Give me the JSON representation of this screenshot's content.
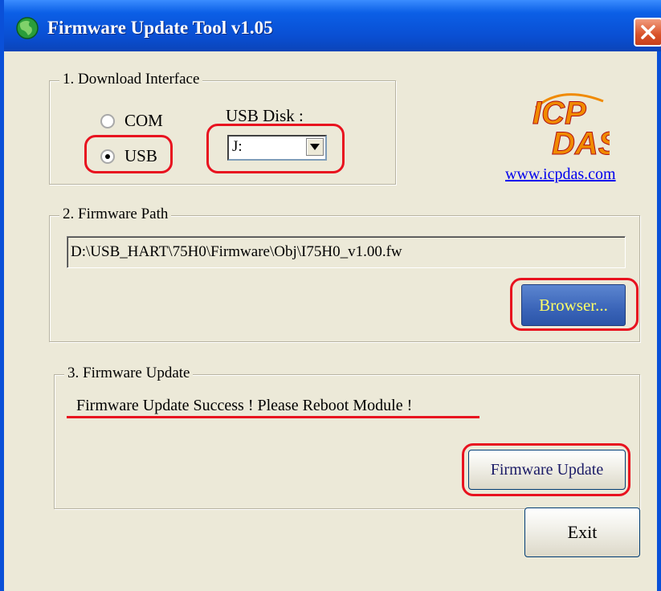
{
  "window": {
    "title": "Firmware Update Tool v1.05"
  },
  "interface_group": {
    "legend": "1. Download Interface",
    "radio_com": "COM",
    "radio_usb": "USB",
    "selected": "USB",
    "usb_disk_label": "USB Disk :",
    "usb_disk_value": "J:"
  },
  "brand": {
    "logo_top": "ICP",
    "logo_bottom": "DAS",
    "link": "www.icpdas.com",
    "logo_color": "#f08a00"
  },
  "path_group": {
    "legend": "2. Firmware Path",
    "path_value": "D:\\USB_HART\\75H0\\Firmware\\Obj\\I75H0_v1.00.fw",
    "browse_label": "Browser..."
  },
  "update_group": {
    "legend": "3. Firmware Update",
    "status": "Firmware Update Success !  Please Reboot Module !",
    "update_label": "Firmware Update"
  },
  "footer": {
    "exit_label": "Exit"
  },
  "colors": {
    "annotation": "#e8121f",
    "titlebar": "#0a4fd3",
    "button_text_blue": "#ffff66"
  }
}
